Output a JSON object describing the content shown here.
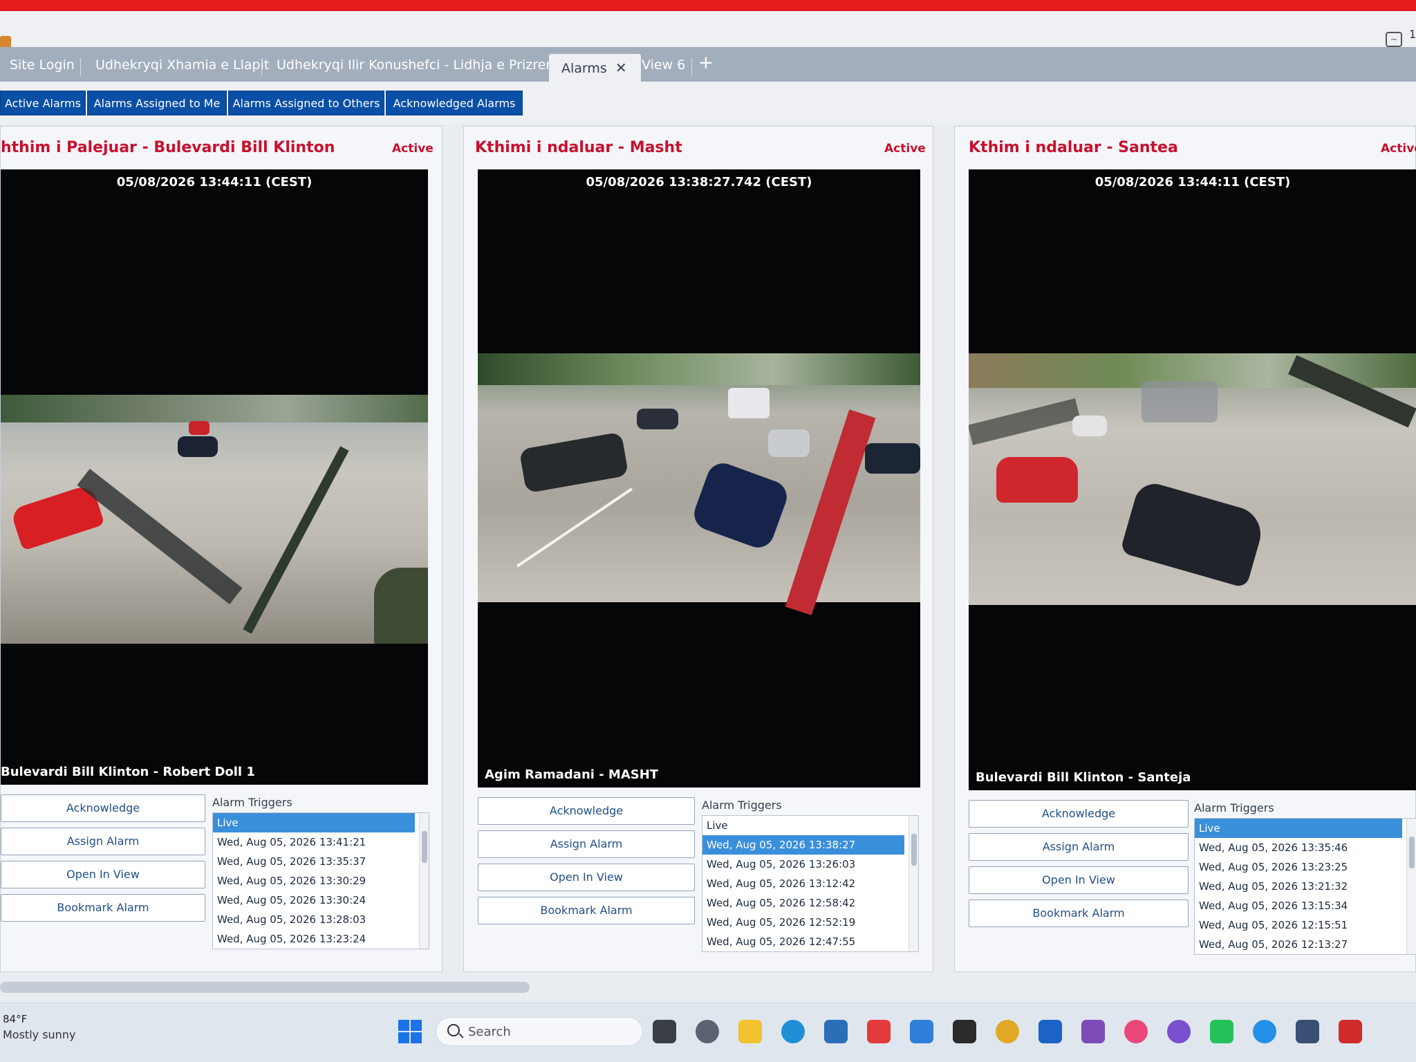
{
  "tabs": [
    {
      "label": "Site Login"
    },
    {
      "label": "Udhekryqi Xhamia e Llapit"
    },
    {
      "label": "Udhekryqi Ilir Konushefci - Lidhja e Prizrenit"
    },
    {
      "label": "Alarms"
    },
    {
      "label": "View 6"
    }
  ],
  "tab_close_glyph": "✕",
  "tab_add_glyph": "+",
  "subtabs": [
    {
      "label": "Active Alarms"
    },
    {
      "label": "Alarms Assigned to Me"
    },
    {
      "label": "Alarms Assigned to Others"
    },
    {
      "label": "Acknowledged Alarms"
    }
  ],
  "panels": [
    {
      "title": "hthim i Palejuar - Bulevardi Bill Klinton",
      "status": "Active",
      "timestamp": "05/08/2026 13:44:11 (CEST)",
      "camera": "Bulevardi Bill Klinton - Robert Doll 1",
      "buttons": {
        "acknowledge": "Acknowledge",
        "assign": "Assign Alarm",
        "open": "Open In View",
        "bookmark": "Bookmark Alarm"
      },
      "triggers_label": "Alarm Triggers",
      "triggers": [
        "Live",
        "Wed, Aug 05, 2026 13:41:21",
        "Wed, Aug 05, 2026 13:35:37",
        "Wed, Aug 05, 2026 13:30:29",
        "Wed, Aug 05, 2026 13:30:24",
        "Wed, Aug 05, 2026 13:28:03",
        "Wed, Aug 05, 2026 13:23:24"
      ]
    },
    {
      "title": "Kthimi i ndaluar - Masht",
      "status": "Active",
      "timestamp": "05/08/2026 13:38:27.742 (CEST)",
      "camera": "Agim Ramadani - MASHT",
      "buttons": {
        "acknowledge": "Acknowledge",
        "assign": "Assign Alarm",
        "open": "Open In View",
        "bookmark": "Bookmark Alarm"
      },
      "triggers_label": "Alarm Triggers",
      "triggers": [
        "Live",
        "Wed, Aug 05, 2026 13:38:27",
        "Wed, Aug 05, 2026 13:26:03",
        "Wed, Aug 05, 2026 13:12:42",
        "Wed, Aug 05, 2026 12:58:42",
        "Wed, Aug 05, 2026 12:52:19",
        "Wed, Aug 05, 2026 12:47:55"
      ]
    },
    {
      "title": "Kthim i ndaluar - Santea",
      "status": "Active",
      "timestamp": "05/08/2026 13:44:11 (CEST)",
      "camera": "Bulevardi Bill Klinton - Santeja",
      "buttons": {
        "acknowledge": "Acknowledge",
        "assign": "Assign Alarm",
        "open": "Open In View",
        "bookmark": "Bookmark Alarm"
      },
      "triggers_label": "Alarm Triggers",
      "triggers": [
        "Live",
        "Wed, Aug 05, 2026 13:35:46",
        "Wed, Aug 05, 2026 13:23:25",
        "Wed, Aug 05, 2026 13:21:32",
        "Wed, Aug 05, 2026 13:15:34",
        "Wed, Aug 05, 2026 12:15:51",
        "Wed, Aug 05, 2026 12:13:27"
      ]
    }
  ],
  "taskbar": {
    "temperature": "84°F",
    "weather": "Mostly sunny",
    "search_label": "Search"
  },
  "title_right_number": "1"
}
